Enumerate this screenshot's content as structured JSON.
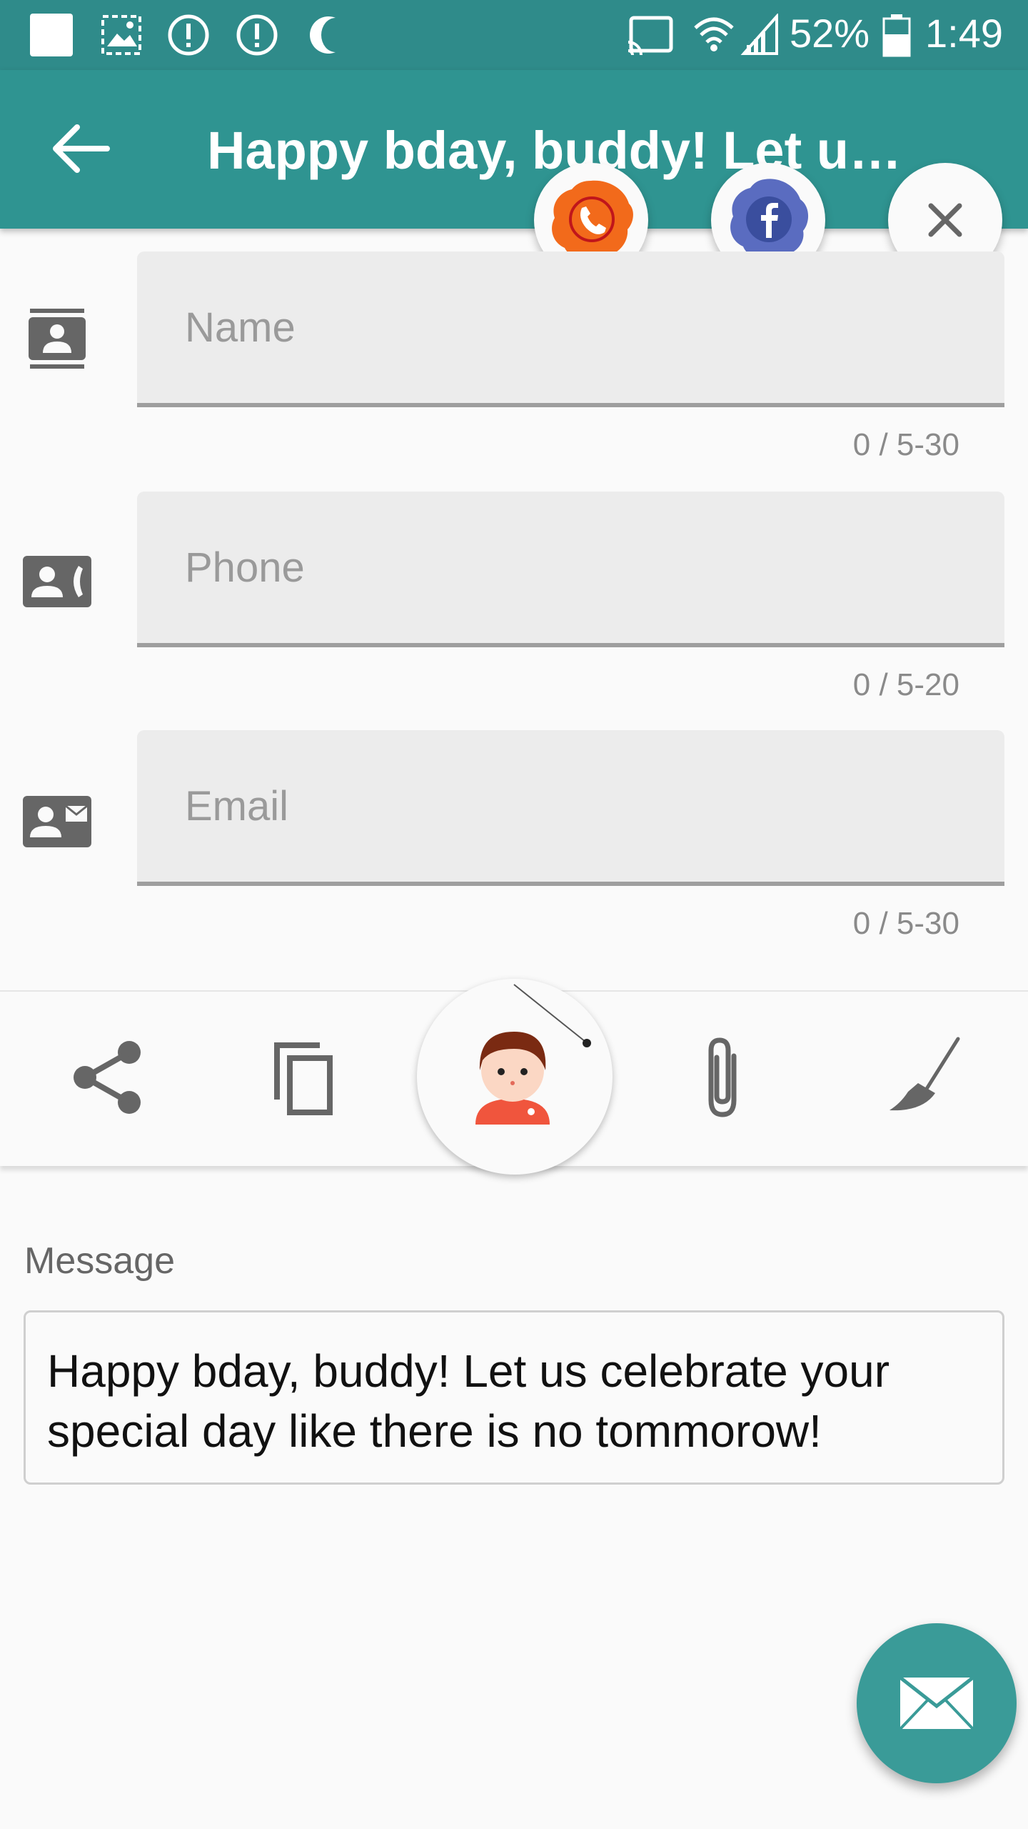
{
  "status_bar": {
    "battery": "52%",
    "time": "1:49"
  },
  "app_bar": {
    "title": "Happy bday, buddy! Let us...",
    "back_icon": "arrow-back-icon"
  },
  "share_targets": [
    {
      "name": "phone-share-icon",
      "color": "#f26a1b"
    },
    {
      "name": "facebook-share-icon",
      "color": "#4a5fb0"
    }
  ],
  "form": {
    "name": {
      "placeholder": "Name",
      "value": "",
      "counter": "0 / 5-30"
    },
    "phone": {
      "placeholder": "Phone",
      "value": "",
      "counter": "0 / 5-20"
    },
    "email": {
      "placeholder": "Email",
      "value": "",
      "counter": "0 / 5-30"
    }
  },
  "toolbar": {
    "items": [
      "share-icon",
      "copy-icon",
      "avatar-icon",
      "attach-icon",
      "broom-icon"
    ]
  },
  "message": {
    "label": "Message",
    "text": "Happy bday, buddy! Let us celebrate your special day like there is no tommorow!"
  },
  "colors": {
    "primary": "#2f9491",
    "status_bar": "#2f8b8a",
    "fab": "#3a9b98"
  }
}
